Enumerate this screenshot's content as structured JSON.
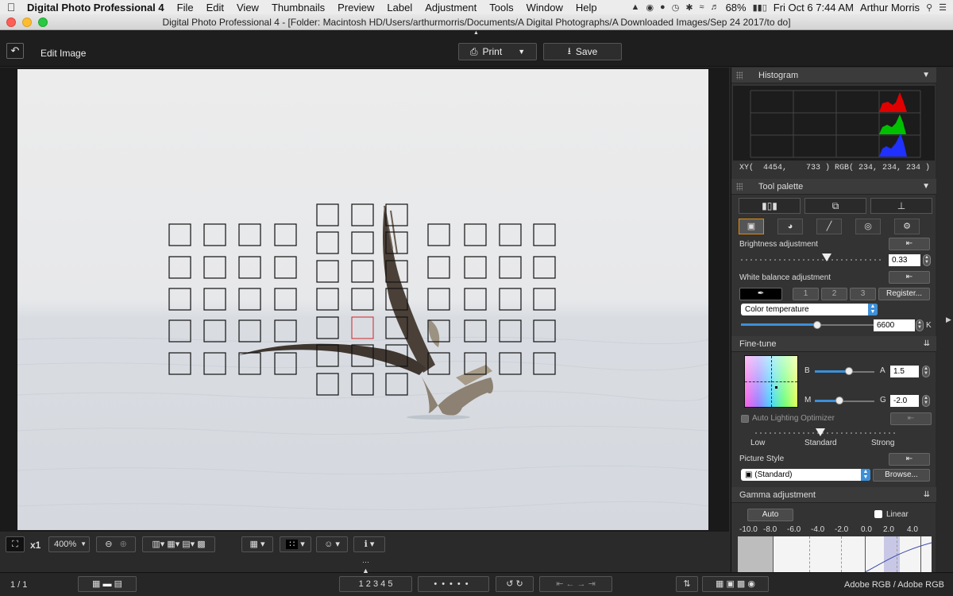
{
  "menubar": {
    "app_name": "Digital Photo Professional 4",
    "items": [
      "File",
      "Edit",
      "View",
      "Thumbnails",
      "Preview",
      "Label",
      "Adjustment",
      "Tools",
      "Window",
      "Help"
    ],
    "battery": "68%",
    "clock": "Fri Oct 6  7:44 AM",
    "user": "Arthur Morris"
  },
  "window": {
    "title": "Digital Photo Professional 4 - [Folder: Macintosh HD/Users/arthurmorris/Documents/A Digital Photographs/A Downloaded Images/Sep 24 2017/to do]"
  },
  "toolbar": {
    "title": "Edit Image",
    "print_label": "Print",
    "save_label": "Save"
  },
  "histogram": {
    "title": "Histogram",
    "readout": "XY(  4454,    733 ) RGB( 234, 234, 234 )"
  },
  "tool_palette": {
    "title": "Tool palette",
    "brightness": {
      "label": "Brightness adjustment",
      "value": "0.33",
      "level": 0.6
    },
    "white_balance": {
      "label": "White balance adjustment",
      "presets": [
        "1",
        "2",
        "3"
      ],
      "register_label": "Register...",
      "mode": "Color temperature",
      "value": "6600",
      "unit": "K",
      "level": 0.6
    },
    "fine_tune": {
      "title": "Fine-tune",
      "b_label": "B",
      "a_label": "A",
      "a_value": "1.5",
      "m_label": "M",
      "g_label": "G",
      "g_value": "-2.0"
    },
    "alo": {
      "label": "Auto Lighting Optimizer",
      "levels": [
        "Low",
        "Standard",
        "Strong"
      ]
    },
    "picture_style": {
      "label": "Picture Style",
      "value": "(Standard)",
      "browse_label": "Browse..."
    },
    "gamma": {
      "title": "Gamma adjustment",
      "auto_label": "Auto",
      "linear_label": "Linear",
      "scale": [
        "-10.0",
        "-8.0",
        "-6.0",
        "-4.0",
        "-2.0",
        "0.0",
        "2.0",
        "4.0"
      ]
    }
  },
  "viewer": {
    "zoom_multiplier": "x1",
    "zoom_level": "400%"
  },
  "statusbar": {
    "page": "1 / 1",
    "ratings": [
      "1",
      "2",
      "3",
      "4",
      "5"
    ],
    "color_space": "Adobe RGB / Adobe RGB"
  },
  "colors": {
    "af_active_point": "#d02424",
    "accent_blue": "#3d8fd8",
    "active_tab_border": "#d78b1c"
  }
}
